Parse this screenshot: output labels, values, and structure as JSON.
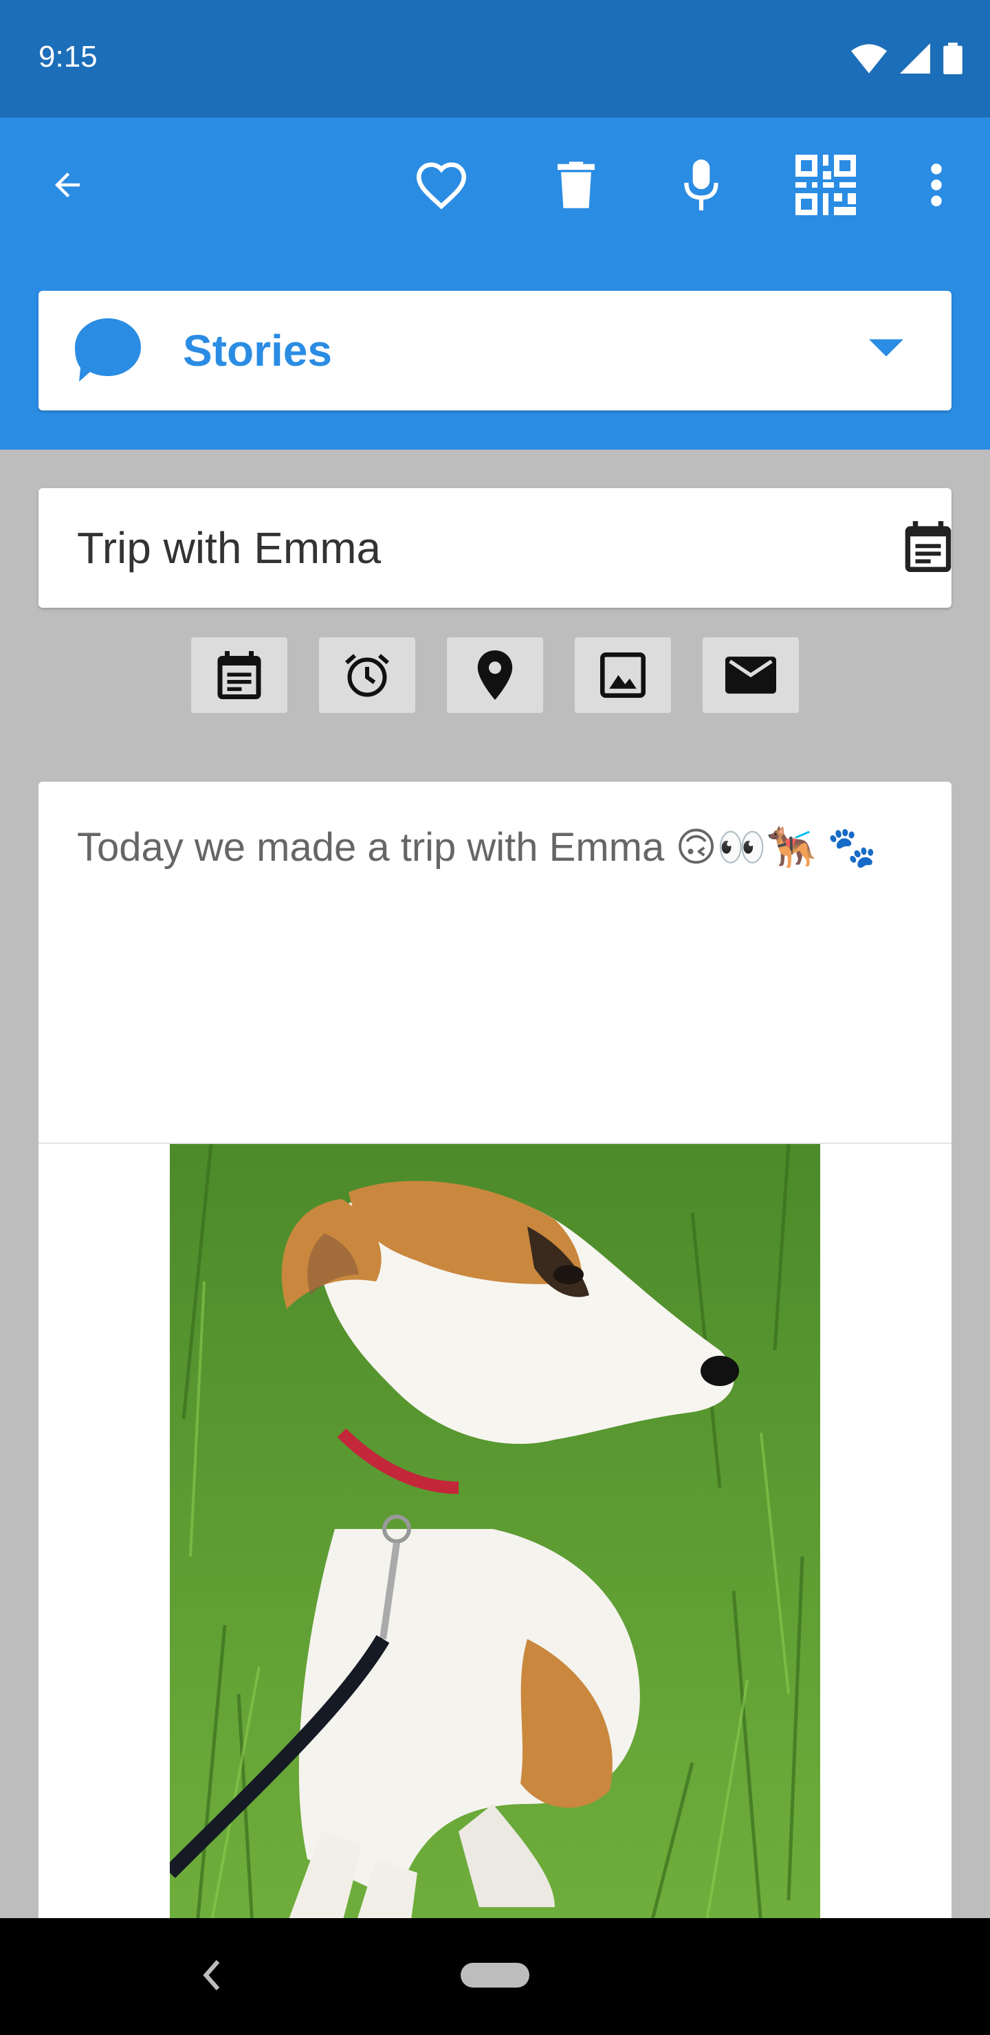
{
  "status_bar": {
    "time": "9:15"
  },
  "toolbar": {
    "back_icon": "arrow-left-icon",
    "favorite_icon": "heart-outline-icon",
    "delete_icon": "trash-icon",
    "mic_icon": "microphone-icon",
    "qr_icon": "qr-code-icon",
    "more_icon": "more-vertical-icon"
  },
  "category": {
    "label": "Stories",
    "icon": "speech-bubble-icon",
    "color": "#2b8ce3"
  },
  "note": {
    "title": "Trip with Emma",
    "body": "Today we made a trip with Emma 🙃👀🐕‍🦺 🐾",
    "image": "dog-photo"
  },
  "tools": [
    {
      "name": "calendar-tool",
      "icon": "calendar-icon"
    },
    {
      "name": "alarm-tool",
      "icon": "alarm-icon"
    },
    {
      "name": "location-tool",
      "icon": "location-pin-icon"
    },
    {
      "name": "image-tool",
      "icon": "image-icon"
    },
    {
      "name": "mail-tool",
      "icon": "mail-icon"
    }
  ],
  "colors": {
    "status_bar": "#1c6eb9",
    "app_bar": "#2b8ce3",
    "background": "#bdbdbd"
  }
}
